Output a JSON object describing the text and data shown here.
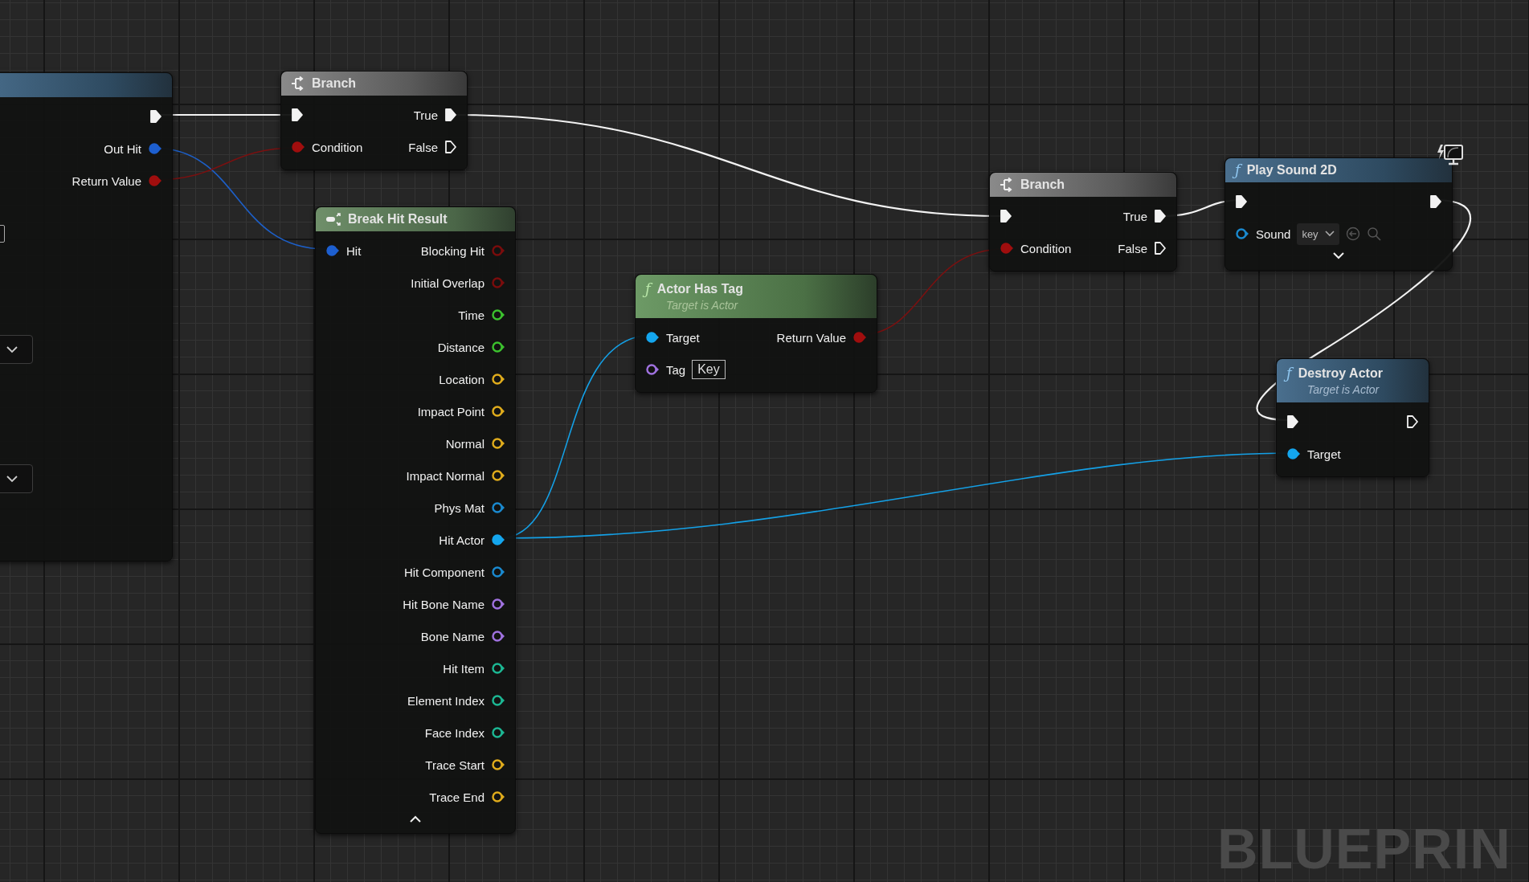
{
  "graph": {
    "watermark": "BLUEPRIN"
  },
  "nodes": [
    {
      "kind": "call",
      "outputs": [
        {
          "kind": "exec",
          "connected": true
        },
        {
          "kind": "data",
          "label": "Out Hit",
          "color": "#1d5fd0",
          "connected": true
        },
        {
          "kind": "data",
          "label": "Return Value",
          "color": "#a00e0e",
          "connected": true
        }
      ],
      "fields": [
        {
          "kind": "text"
        },
        {
          "kind": "dropdown"
        },
        {
          "kind": "dropdown"
        }
      ]
    },
    {
      "kind": "flow",
      "title": "Branch",
      "inputs": [
        {
          "kind": "exec",
          "connected": true
        },
        {
          "kind": "data",
          "label": "Condition",
          "color": "#a00e0e",
          "connected": true
        }
      ],
      "outputs": [
        {
          "kind": "exec",
          "label": "True",
          "connected": true
        },
        {
          "kind": "exec",
          "label": "False",
          "connected": false
        }
      ]
    },
    {
      "kind": "struct",
      "title": "Break Hit Result",
      "advanced_expanded": true,
      "inputs": [
        {
          "kind": "data",
          "label": "Hit",
          "color": "#1d5fd0",
          "connected": true
        }
      ],
      "outputs": [
        {
          "kind": "data",
          "label": "Blocking Hit",
          "color": "#7a0c0c",
          "connected": false
        },
        {
          "kind": "data",
          "label": "Initial Overlap",
          "color": "#7a0c0c",
          "connected": false
        },
        {
          "kind": "data",
          "label": "Time",
          "color": "#3cc22e",
          "connected": false
        },
        {
          "kind": "data",
          "label": "Distance",
          "color": "#3cc22e",
          "connected": false
        },
        {
          "kind": "data",
          "label": "Location",
          "color": "#e0ac1c",
          "connected": false
        },
        {
          "kind": "data",
          "label": "Impact Point",
          "color": "#e0ac1c",
          "connected": false
        },
        {
          "kind": "data",
          "label": "Normal",
          "color": "#e0ac1c",
          "connected": false
        },
        {
          "kind": "data",
          "label": "Impact Normal",
          "color": "#e0ac1c",
          "connected": false
        },
        {
          "kind": "data",
          "label": "Phys Mat",
          "color": "#1a8ad0",
          "connected": false
        },
        {
          "kind": "data",
          "label": "Hit Actor",
          "color": "#14a6ee",
          "connected": true
        },
        {
          "kind": "data",
          "label": "Hit Component",
          "color": "#1a8ad0",
          "connected": false
        },
        {
          "kind": "data",
          "label": "Hit Bone Name",
          "color": "#a072e0",
          "connected": false
        },
        {
          "kind": "data",
          "label": "Bone Name",
          "color": "#a072e0",
          "connected": false
        },
        {
          "kind": "data",
          "label": "Hit Item",
          "color": "#1cb894",
          "connected": false
        },
        {
          "kind": "data",
          "label": "Element Index",
          "color": "#1cb894",
          "connected": false
        },
        {
          "kind": "data",
          "label": "Face Index",
          "color": "#1cb894",
          "connected": false
        },
        {
          "kind": "data",
          "label": "Trace Start",
          "color": "#e0ac1c",
          "connected": false
        },
        {
          "kind": "data",
          "label": "Trace End",
          "color": "#e0ac1c",
          "connected": false
        }
      ]
    },
    {
      "kind": "pure",
      "icon": "ƒ",
      "title": "Actor Has Tag",
      "subtitle": "Target is Actor",
      "inputs": [
        {
          "kind": "data",
          "label": "Target",
          "color": "#14a6ee",
          "connected": true
        },
        {
          "kind": "data",
          "label": "Tag",
          "color": "#a072e0",
          "connected": false,
          "value": "Key"
        }
      ],
      "outputs": [
        {
          "kind": "data",
          "label": "Return Value",
          "color": "#a00e0e",
          "connected": true
        }
      ]
    },
    {
      "kind": "flow",
      "title": "Branch",
      "inputs": [
        {
          "kind": "exec",
          "connected": true
        },
        {
          "kind": "data",
          "label": "Condition",
          "color": "#a00e0e",
          "connected": true
        }
      ],
      "outputs": [
        {
          "kind": "exec",
          "label": "True",
          "connected": true
        },
        {
          "kind": "exec",
          "label": "False",
          "connected": false
        }
      ]
    },
    {
      "kind": "call",
      "icon": "ƒ",
      "title": "Play Sound 2D",
      "client_only": true,
      "advanced_expanded": false,
      "inputs": [
        {
          "kind": "exec",
          "connected": true
        },
        {
          "kind": "data",
          "label": "Sound",
          "color": "#1a8ad0",
          "connected": false,
          "asset": "key"
        }
      ],
      "outputs": [
        {
          "kind": "exec",
          "connected": true
        }
      ]
    },
    {
      "kind": "call",
      "icon": "ƒ",
      "title": "Destroy Actor",
      "subtitle": "Target is Actor",
      "inputs": [
        {
          "kind": "exec",
          "connected": true
        },
        {
          "kind": "data",
          "label": "Target",
          "color": "#14a6ee",
          "connected": true
        }
      ],
      "outputs": [
        {
          "kind": "exec",
          "connected": false
        }
      ]
    }
  ]
}
